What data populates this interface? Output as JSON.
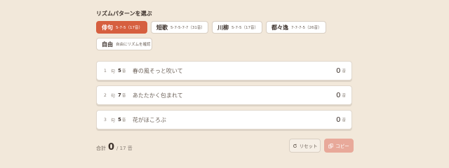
{
  "section_title": "リズムパターンを選ぶ",
  "patterns": [
    {
      "name": "俳句",
      "desc": "5-7-5（17音）",
      "active": true
    },
    {
      "name": "短歌",
      "desc": "5-7-5-7-7（31音）",
      "active": false
    },
    {
      "name": "川柳",
      "desc": "5-7-5（17音）",
      "active": false
    },
    {
      "name": "都々逸",
      "desc": "7-7-7-5（26音）",
      "active": false
    },
    {
      "name": "自由",
      "desc": "自由にリズムを確認",
      "active": false
    }
  ],
  "lines": [
    {
      "index": "1",
      "ku": "句",
      "target": "5",
      "target_unit": "音",
      "text": "春の風そっと吹いて",
      "count": "0",
      "count_unit": "音"
    },
    {
      "index": "2",
      "ku": "句",
      "target": "7",
      "target_unit": "音",
      "text": "あたたかく包まれて",
      "count": "0",
      "count_unit": "音"
    },
    {
      "index": "3",
      "ku": "句",
      "target": "5",
      "target_unit": "音",
      "text": "花がほころぶ",
      "count": "0",
      "count_unit": "音"
    }
  ],
  "total": {
    "label": "合計",
    "value": "0",
    "max": "/ 17 音"
  },
  "buttons": {
    "reset": "リセット",
    "copy": "コピー"
  },
  "colors": {
    "accent": "#d65f3f",
    "background": "#f2e8da",
    "copy_disabled": "#e8a99a"
  },
  "icons": {
    "reset": "reset-icon",
    "copy": "copy-icon"
  }
}
